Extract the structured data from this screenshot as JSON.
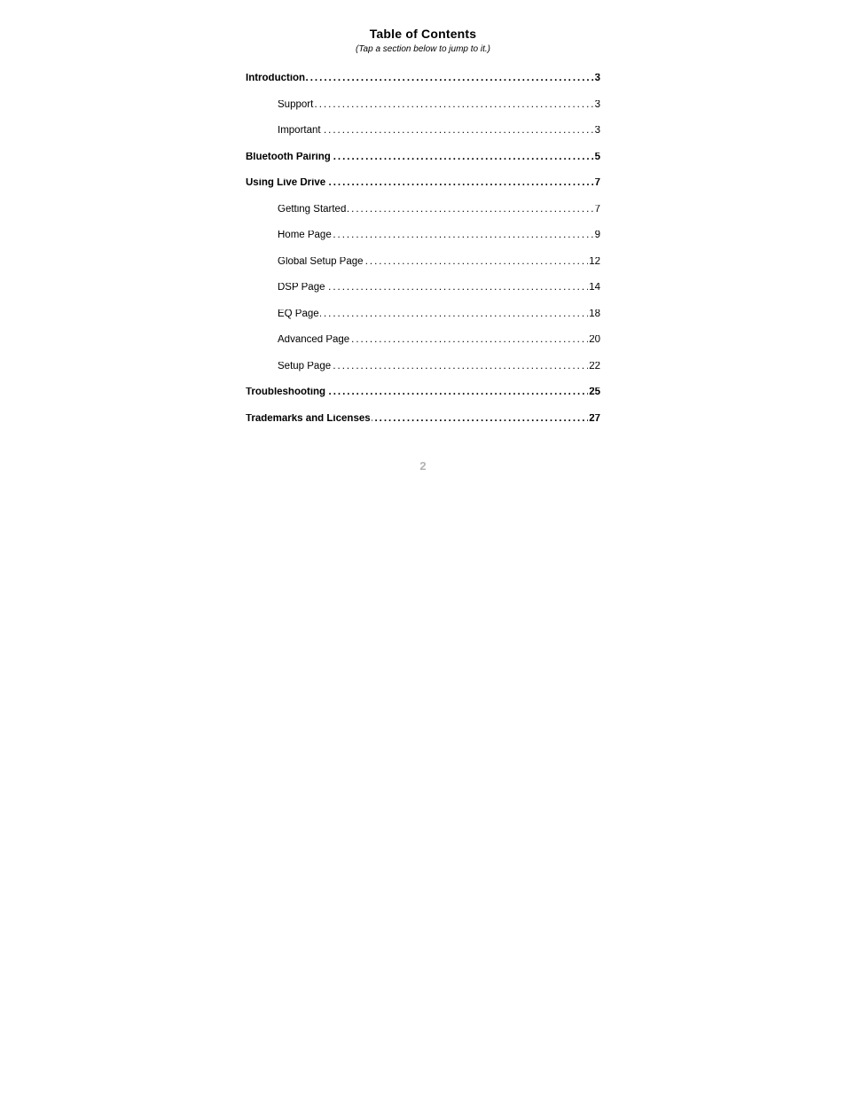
{
  "title": "Table of Contents",
  "subtitle": "(Tap a section below to jump to it.)",
  "entries": [
    {
      "label": "Introduction",
      "page": "3",
      "level": 1
    },
    {
      "label": "Support",
      "page": "3",
      "level": 2
    },
    {
      "label": "Important",
      "page": "3",
      "level": 2
    },
    {
      "label": "Bluetooth Pairing",
      "page": "5",
      "level": 1
    },
    {
      "label": "Using Live Drive",
      "page": "7",
      "level": 1
    },
    {
      "label": "Getting Started",
      "page": "7",
      "level": 2
    },
    {
      "label": "Home Page",
      "page": "9",
      "level": 2
    },
    {
      "label": "Global Setup Page",
      "page": "12",
      "level": 2
    },
    {
      "label": "DSP Page",
      "page": "14",
      "level": 2
    },
    {
      "label": "EQ Page",
      "page": "18",
      "level": 2
    },
    {
      "label": "Advanced Page",
      "page": "20",
      "level": 2
    },
    {
      "label": "Setup Page",
      "page": "22",
      "level": 2
    },
    {
      "label": "Troubleshooting",
      "page": "25",
      "level": 1
    },
    {
      "label": "Trademarks and Licenses",
      "page": "27",
      "level": 1
    }
  ],
  "page_number": "2"
}
